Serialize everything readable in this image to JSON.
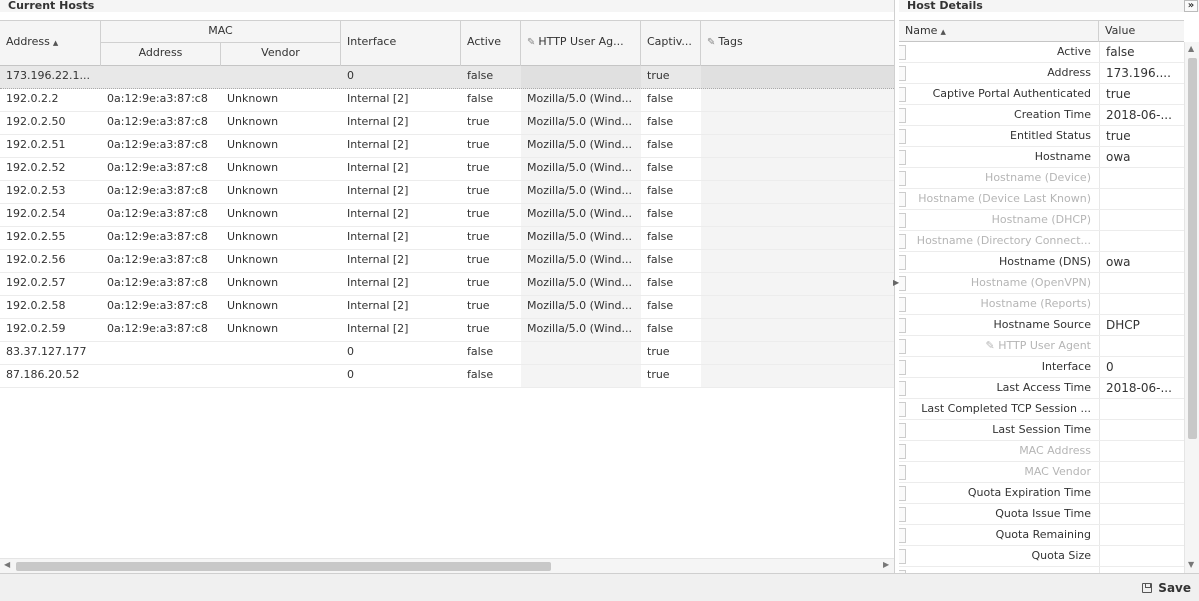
{
  "left_panel": {
    "title": "Current Hosts",
    "columns": {
      "address": "Address",
      "mac_group": "MAC",
      "mac_address": "Address",
      "mac_vendor": "Vendor",
      "interface": "Interface",
      "active": "Active",
      "http_user_agent": "HTTP User Ag...",
      "captive": "Captiv...",
      "tags": "Tags"
    },
    "rows": [
      {
        "address": "173.196.22.1...",
        "mac": "",
        "vendor": "",
        "interface": "0",
        "active": "false",
        "ua": "",
        "captive": "true",
        "tags": ""
      },
      {
        "address": "192.0.2.2",
        "mac": "0a:12:9e:a3:87:c8",
        "vendor": "Unknown",
        "interface": "Internal [2]",
        "active": "false",
        "ua": "Mozilla/5.0 (Wind...",
        "captive": "false",
        "tags": ""
      },
      {
        "address": "192.0.2.50",
        "mac": "0a:12:9e:a3:87:c8",
        "vendor": "Unknown",
        "interface": "Internal [2]",
        "active": "true",
        "ua": "Mozilla/5.0 (Wind...",
        "captive": "false",
        "tags": ""
      },
      {
        "address": "192.0.2.51",
        "mac": "0a:12:9e:a3:87:c8",
        "vendor": "Unknown",
        "interface": "Internal [2]",
        "active": "true",
        "ua": "Mozilla/5.0 (Wind...",
        "captive": "false",
        "tags": ""
      },
      {
        "address": "192.0.2.52",
        "mac": "0a:12:9e:a3:87:c8",
        "vendor": "Unknown",
        "interface": "Internal [2]",
        "active": "true",
        "ua": "Mozilla/5.0 (Wind...",
        "captive": "false",
        "tags": ""
      },
      {
        "address": "192.0.2.53",
        "mac": "0a:12:9e:a3:87:c8",
        "vendor": "Unknown",
        "interface": "Internal [2]",
        "active": "true",
        "ua": "Mozilla/5.0 (Wind...",
        "captive": "false",
        "tags": ""
      },
      {
        "address": "192.0.2.54",
        "mac": "0a:12:9e:a3:87:c8",
        "vendor": "Unknown",
        "interface": "Internal [2]",
        "active": "true",
        "ua": "Mozilla/5.0 (Wind...",
        "captive": "false",
        "tags": ""
      },
      {
        "address": "192.0.2.55",
        "mac": "0a:12:9e:a3:87:c8",
        "vendor": "Unknown",
        "interface": "Internal [2]",
        "active": "true",
        "ua": "Mozilla/5.0 (Wind...",
        "captive": "false",
        "tags": ""
      },
      {
        "address": "192.0.2.56",
        "mac": "0a:12:9e:a3:87:c8",
        "vendor": "Unknown",
        "interface": "Internal [2]",
        "active": "true",
        "ua": "Mozilla/5.0 (Wind...",
        "captive": "false",
        "tags": ""
      },
      {
        "address": "192.0.2.57",
        "mac": "0a:12:9e:a3:87:c8",
        "vendor": "Unknown",
        "interface": "Internal [2]",
        "active": "true",
        "ua": "Mozilla/5.0 (Wind...",
        "captive": "false",
        "tags": ""
      },
      {
        "address": "192.0.2.58",
        "mac": "0a:12:9e:a3:87:c8",
        "vendor": "Unknown",
        "interface": "Internal [2]",
        "active": "true",
        "ua": "Mozilla/5.0 (Wind...",
        "captive": "false",
        "tags": ""
      },
      {
        "address": "192.0.2.59",
        "mac": "0a:12:9e:a3:87:c8",
        "vendor": "Unknown",
        "interface": "Internal [2]",
        "active": "true",
        "ua": "Mozilla/5.0 (Wind...",
        "captive": "false",
        "tags": ""
      },
      {
        "address": "83.37.127.177",
        "mac": "",
        "vendor": "",
        "interface": "0",
        "active": "false",
        "ua": "",
        "captive": "true",
        "tags": ""
      },
      {
        "address": "87.186.20.52",
        "mac": "",
        "vendor": "",
        "interface": "0",
        "active": "false",
        "ua": "",
        "captive": "true",
        "tags": ""
      }
    ]
  },
  "right_panel": {
    "title": "Host Details",
    "collapse_glyph": "»",
    "columns": {
      "name": "Name",
      "value": "Value"
    },
    "rows": [
      {
        "name": "Active",
        "value": "false",
        "dim": false
      },
      {
        "name": "Address",
        "value": "173.196....",
        "dim": false
      },
      {
        "name": "Captive Portal Authenticated",
        "value": "true",
        "dim": false
      },
      {
        "name": "Creation Time",
        "value": "2018-06-...",
        "dim": false
      },
      {
        "name": "Entitled Status",
        "value": "true",
        "dim": false
      },
      {
        "name": "Hostname",
        "value": "owa",
        "dim": false
      },
      {
        "name": "Hostname (Device)",
        "value": "",
        "dim": true
      },
      {
        "name": "Hostname (Device Last Known)",
        "value": "",
        "dim": true
      },
      {
        "name": "Hostname (DHCP)",
        "value": "",
        "dim": true
      },
      {
        "name": "Hostname (Directory Connect...",
        "value": "",
        "dim": true
      },
      {
        "name": "Hostname (DNS)",
        "value": "owa",
        "dim": false
      },
      {
        "name": "Hostname (OpenVPN)",
        "value": "",
        "dim": true
      },
      {
        "name": "Hostname (Reports)",
        "value": "",
        "dim": true
      },
      {
        "name": "Hostname Source",
        "value": "DHCP",
        "dim": false
      },
      {
        "name": "✎ HTTP User Agent",
        "value": "",
        "dim": true
      },
      {
        "name": "Interface",
        "value": "0",
        "dim": false
      },
      {
        "name": "Last Access Time",
        "value": "2018-06-...",
        "dim": false
      },
      {
        "name": "Last Completed TCP Session ...",
        "value": "",
        "dim": false
      },
      {
        "name": "Last Session Time",
        "value": "",
        "dim": false
      },
      {
        "name": "MAC Address",
        "value": "",
        "dim": true
      },
      {
        "name": "MAC Vendor",
        "value": "",
        "dim": true
      },
      {
        "name": "Quota Expiration Time",
        "value": "",
        "dim": false
      },
      {
        "name": "Quota Issue Time",
        "value": "",
        "dim": false
      },
      {
        "name": "Quota Remaining",
        "value": "",
        "dim": false
      },
      {
        "name": "Quota Size",
        "value": "",
        "dim": false
      },
      {
        "name": "",
        "value": "",
        "dim": false
      }
    ]
  },
  "footer": {
    "save_label": "Save"
  }
}
